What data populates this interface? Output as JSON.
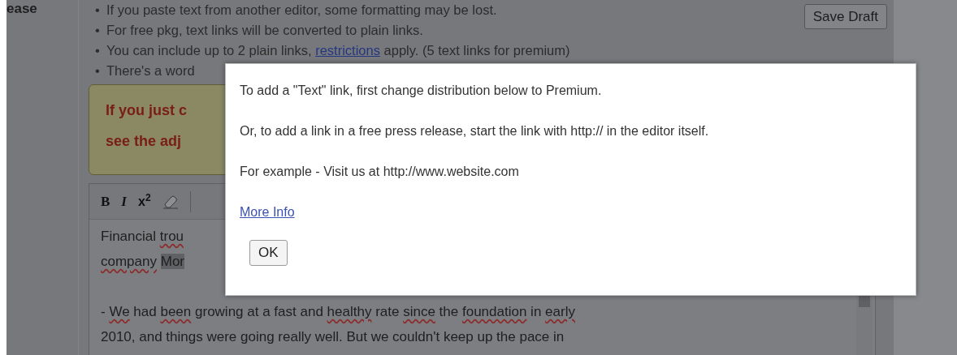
{
  "side_label": "ease",
  "notes": [
    {
      "marker": "•",
      "segments": [
        {
          "text": "If you paste text from another editor, some formatting may be lost.",
          "kind": "plain"
        }
      ]
    },
    {
      "marker": "•",
      "segments": [
        {
          "text": "For free pkg, text links will be converted to plain links.",
          "kind": "plain"
        }
      ]
    },
    {
      "marker": "•",
      "segments": [
        {
          "text": "You can include up to 2 plain links,",
          "kind": "plain"
        },
        {
          "text": "restrictions",
          "kind": "link"
        },
        {
          "text": "apply. (5 text links for premium)",
          "kind": "plain"
        }
      ]
    },
    {
      "marker": "•",
      "segments": [
        {
          "text": "There's a word",
          "kind": "plain"
        }
      ]
    }
  ],
  "save_button": "Save Draft",
  "notice": {
    "lines": [
      "If you just c",
      "see the adj"
    ]
  },
  "toolbar": [
    {
      "kind": "bold",
      "label": "B"
    },
    {
      "kind": "italic",
      "label": "I"
    },
    {
      "kind": "superscript",
      "label": "x$^{2}$"
    },
    {
      "kind": "eraser"
    }
  ],
  "editor": {
    "paragraphs": [
      {
        "lines": [
          {
            "segments": [
              {
                "text": "Financial",
                "kind": "plain"
              },
              {
                "text": "trou",
                "kind": "flagged"
              }
            ]
          },
          {
            "segments": [
              {
                "text": "company",
                "kind": "flagged"
              },
              {
                "text": "Mor",
                "kind": "highlight"
              }
            ]
          }
        ]
      },
      {
        "lines": [
          {
            "segments": [
              {
                "text": "-",
                "kind": "plain"
              },
              {
                "text": "We",
                "kind": "flagged"
              },
              {
                "text": "had",
                "kind": "plain"
              },
              {
                "text": "been",
                "kind": "flagged"
              },
              {
                "text": "growing at a fast and",
                "kind": "plain"
              },
              {
                "text": "healthy",
                "kind": "flagged"
              },
              {
                "text": "rate",
                "kind": "plain"
              },
              {
                "text": "since",
                "kind": "flagged"
              },
              {
                "text": "the",
                "kind": "plain"
              },
              {
                "text": "foundation",
                "kind": "flagged"
              },
              {
                "text": "in",
                "kind": "plain"
              },
              {
                "text": "early",
                "kind": "flagged"
              }
            ]
          },
          {
            "segments": [
              {
                "text": "2010, and things were going really well. But we couldn't keep up the pace in",
                "kind": "plain"
              }
            ]
          }
        ]
      }
    ]
  },
  "dialog": {
    "lines": [
      "To add a \"Text\" link, first change distribution below to Premium.",
      "Or, to add a link in a free press release, start the link with http:// in the editor itself.",
      "For example - Visit us at http://www.website.com"
    ],
    "link": "More Info",
    "button": "OK"
  }
}
